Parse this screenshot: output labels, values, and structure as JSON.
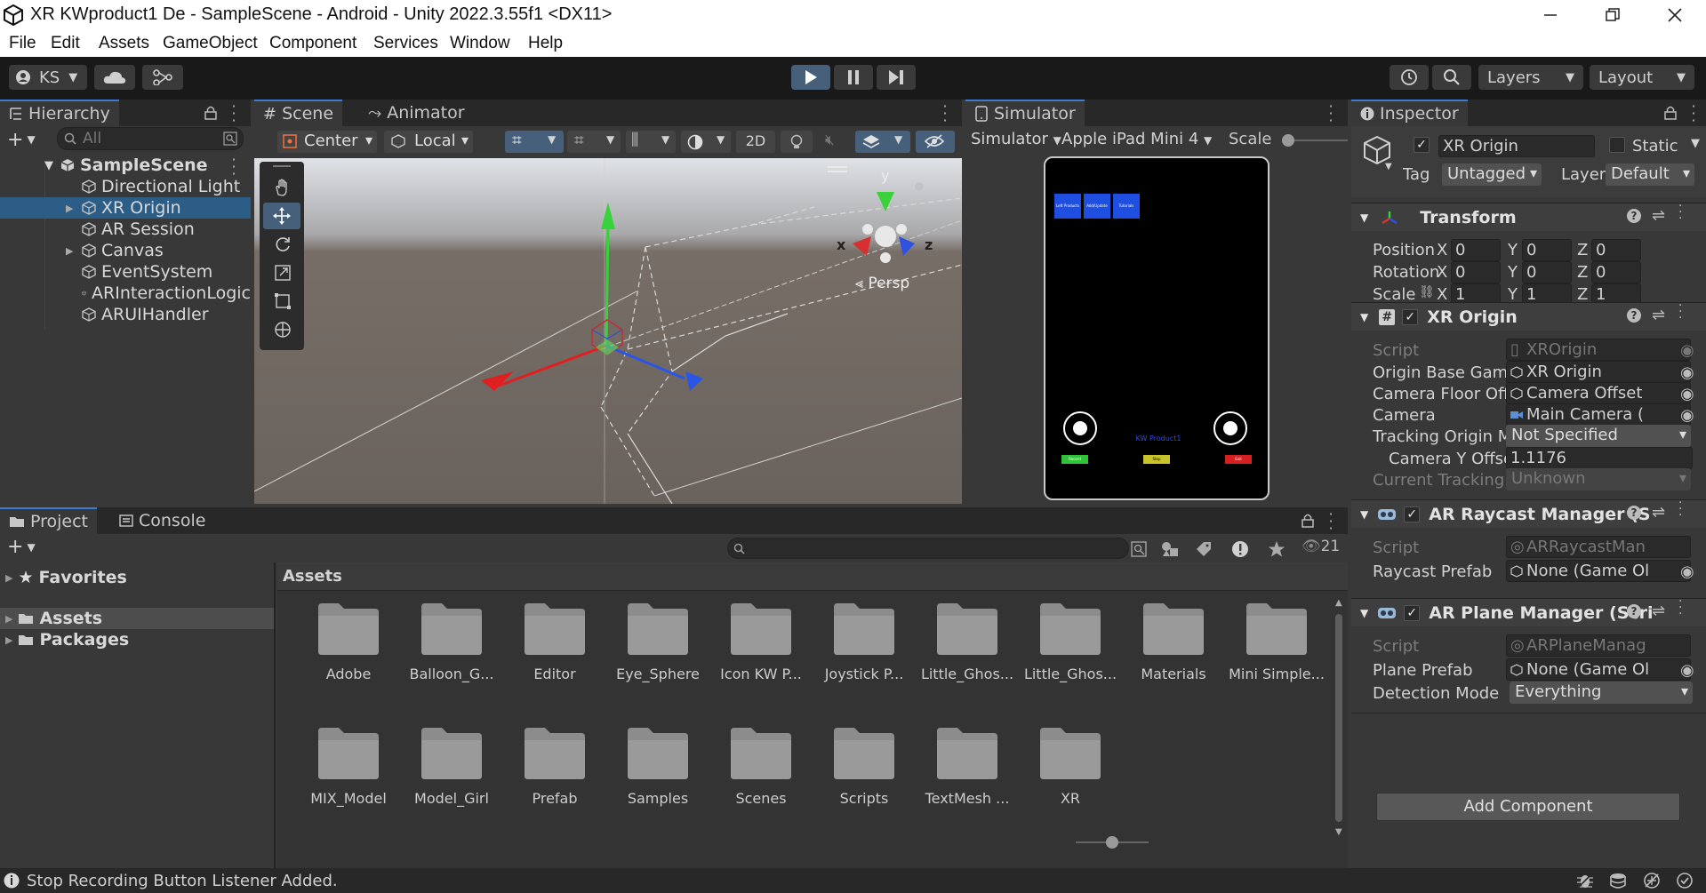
{
  "window": {
    "title": "XR KWproduct1 De - SampleScene - Android - Unity 2022.3.55f1 <DX11>"
  },
  "menu": [
    "File",
    "Edit",
    "Assets",
    "GameObject",
    "Component",
    "Services",
    "Window",
    "Help"
  ],
  "toolbar": {
    "account": "KS",
    "layers": "Layers",
    "layout": "Layout"
  },
  "hierarchy": {
    "tab": "Hierarchy",
    "search_placeholder": "All",
    "scene": "SampleScene",
    "items": [
      "Directional Light",
      "XR Origin",
      "AR Session",
      "Canvas",
      "EventSystem",
      "ARInteractionLogic",
      "ARUIHandler"
    ],
    "selected_index": 1
  },
  "scene": {
    "tabs": [
      "Scene",
      "Animator"
    ],
    "pivot": "Center",
    "space": "Local",
    "mode2d": "2D",
    "persp": "Persp",
    "gizmo": {
      "x": "x",
      "y": "y",
      "z": "z"
    }
  },
  "simulator": {
    "tab": "Simulator",
    "mode": "Simulator",
    "device": "Apple iPad Mini 4",
    "scale": "Scale",
    "screen_label": "KW Product1",
    "top_buttons": [
      "Left Products",
      "Add/Update",
      "Tutorials"
    ],
    "bottom_buttons": [
      "Record",
      "Stop",
      "Exit"
    ],
    "bottom_colors": [
      "#31c23a",
      "#c7c32d",
      "#d42020"
    ]
  },
  "inspector": {
    "tab": "Inspector",
    "object_name": "XR Origin",
    "static_label": "Static",
    "tag_label": "Tag",
    "tag_value": "Untagged",
    "layer_label": "Layer",
    "layer_value": "Default",
    "transform": {
      "title": "Transform",
      "rows": [
        {
          "label": "Position",
          "x": "0",
          "y": "0",
          "z": "0"
        },
        {
          "label": "Rotation",
          "x": "0",
          "y": "0",
          "z": "0"
        },
        {
          "label": "Scale",
          "x": "1",
          "y": "1",
          "z": "1"
        }
      ]
    },
    "xr_origin": {
      "title": "XR Origin",
      "script_label": "Script",
      "script_value": "XROrigin",
      "origin_label": "Origin Base GameOb",
      "origin_value": "XR Origin",
      "floor_label": "Camera Floor Offset",
      "floor_value": "Camera Offset",
      "camera_label": "Camera",
      "camera_value": "Main Camera (",
      "tracking_label": "Tracking Origin Mod",
      "tracking_value": "Not Specified",
      "ycam_label": "Camera Y Offset",
      "ycam_value": "1.1176",
      "current_label": "Current Tracking Ori",
      "current_value": "Unknown"
    },
    "raycast": {
      "title": "AR Raycast Manager (S",
      "script_label": "Script",
      "script_value": "ARRaycastMan",
      "prefab_label": "Raycast Prefab",
      "prefab_value": "None (Game Ol"
    },
    "plane": {
      "title": "AR Plane Manager (Scri",
      "script_label": "Script",
      "script_value": "ARPlaneManag",
      "prefab_label": "Plane Prefab",
      "prefab_value": "None (Game Ol",
      "mode_label": "Detection Mode",
      "mode_value": "Everything"
    },
    "add_component": "Add Component"
  },
  "project": {
    "tabs": [
      "Project",
      "Console"
    ],
    "favorites": "Favorites",
    "assets": "Assets",
    "packages": "Packages",
    "breadcrumb": "Assets",
    "hidden_count": "21",
    "folders_row1": [
      "Adobe",
      "Balloon_G...",
      "Editor",
      "Eye_Sphere",
      "Icon KW P...",
      "Joystick P...",
      "Little_Ghos...",
      "Little_Ghos...",
      "Materials",
      "Mini Simple..."
    ],
    "folders_row2": [
      "MIX_Model",
      "Model_Girl",
      "Prefab",
      "Samples",
      "Scenes",
      "Scripts",
      "TextMesh ...",
      "XR"
    ]
  },
  "status": {
    "message": "Stop Recording Button Listener Added."
  }
}
